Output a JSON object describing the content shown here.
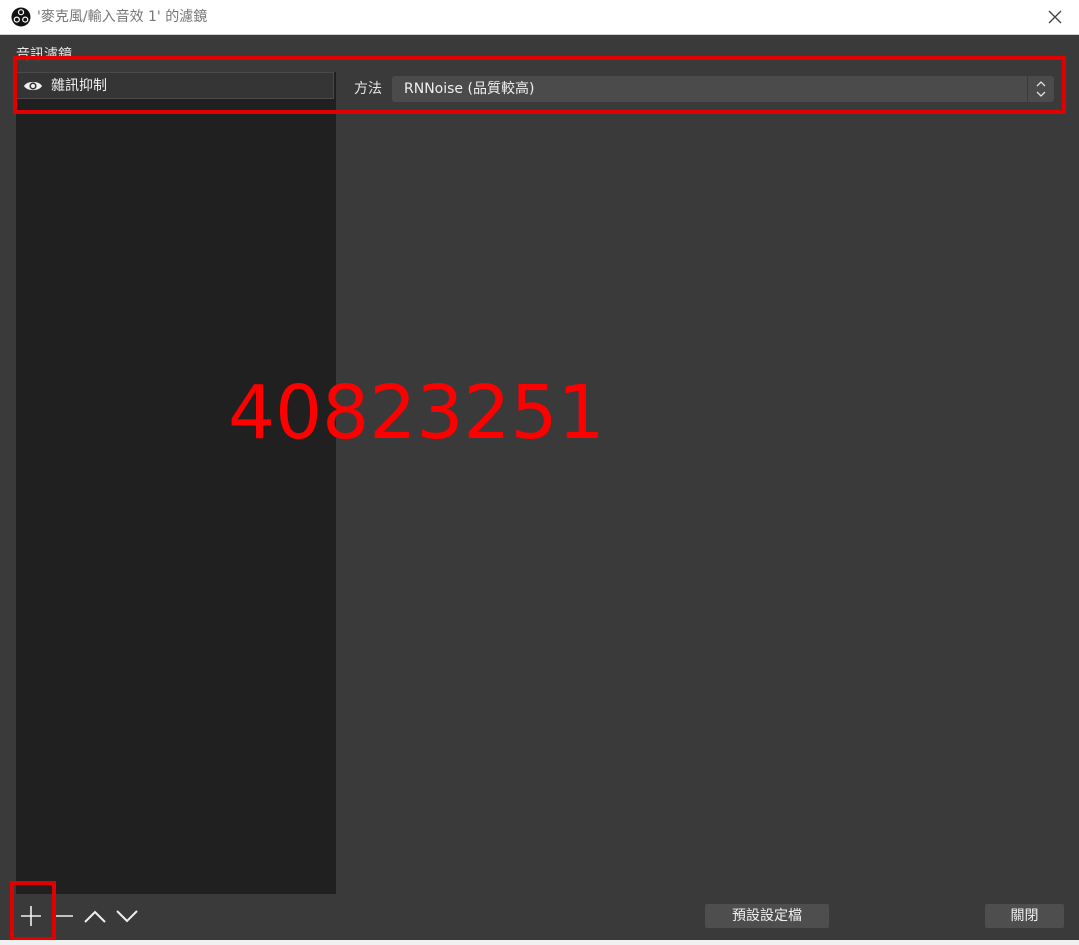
{
  "window": {
    "title": "'麥克風/輸入音效 1' 的濾鏡",
    "app_icon": "obs-logo-icon",
    "close_icon": "close-icon"
  },
  "audio_filters": {
    "section_label": "音訊濾鏡",
    "items": [
      {
        "label": "雜訊抑制",
        "visible_icon": "eye-icon",
        "enabled": true
      }
    ]
  },
  "properties": {
    "method_label": "方法",
    "method_value": "RNNoise (品質較高)"
  },
  "toolbar": {
    "add_icon": "plus-icon",
    "remove_icon": "minus-icon",
    "move_up_icon": "chevron-up-icon",
    "move_down_icon": "chevron-down-icon"
  },
  "buttons": {
    "defaults_label": "預設設定檔",
    "close_label": "關閉"
  },
  "overlay": {
    "watermark_text": "40823251"
  },
  "colors": {
    "highlight": "#e00000",
    "watermark": "#ff0000",
    "panel_bg": "#202020",
    "window_bg": "#3a3a3a"
  }
}
